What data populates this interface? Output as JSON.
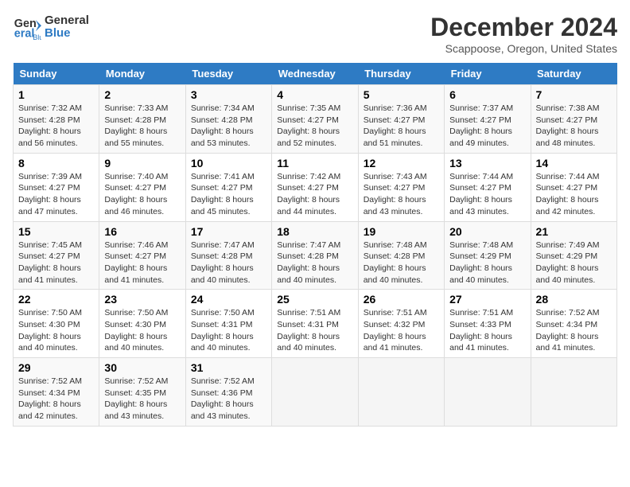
{
  "header": {
    "logo_line1": "General",
    "logo_line2": "Blue",
    "title": "December 2024",
    "subtitle": "Scappoose, Oregon, United States"
  },
  "weekdays": [
    "Sunday",
    "Monday",
    "Tuesday",
    "Wednesday",
    "Thursday",
    "Friday",
    "Saturday"
  ],
  "weeks": [
    [
      {
        "day": "1",
        "rise": "Sunrise: 7:32 AM",
        "set": "Sunset: 4:28 PM",
        "daylight": "Daylight: 8 hours and 56 minutes."
      },
      {
        "day": "2",
        "rise": "Sunrise: 7:33 AM",
        "set": "Sunset: 4:28 PM",
        "daylight": "Daylight: 8 hours and 55 minutes."
      },
      {
        "day": "3",
        "rise": "Sunrise: 7:34 AM",
        "set": "Sunset: 4:28 PM",
        "daylight": "Daylight: 8 hours and 53 minutes."
      },
      {
        "day": "4",
        "rise": "Sunrise: 7:35 AM",
        "set": "Sunset: 4:27 PM",
        "daylight": "Daylight: 8 hours and 52 minutes."
      },
      {
        "day": "5",
        "rise": "Sunrise: 7:36 AM",
        "set": "Sunset: 4:27 PM",
        "daylight": "Daylight: 8 hours and 51 minutes."
      },
      {
        "day": "6",
        "rise": "Sunrise: 7:37 AM",
        "set": "Sunset: 4:27 PM",
        "daylight": "Daylight: 8 hours and 49 minutes."
      },
      {
        "day": "7",
        "rise": "Sunrise: 7:38 AM",
        "set": "Sunset: 4:27 PM",
        "daylight": "Daylight: 8 hours and 48 minutes."
      }
    ],
    [
      {
        "day": "8",
        "rise": "Sunrise: 7:39 AM",
        "set": "Sunset: 4:27 PM",
        "daylight": "Daylight: 8 hours and 47 minutes."
      },
      {
        "day": "9",
        "rise": "Sunrise: 7:40 AM",
        "set": "Sunset: 4:27 PM",
        "daylight": "Daylight: 8 hours and 46 minutes."
      },
      {
        "day": "10",
        "rise": "Sunrise: 7:41 AM",
        "set": "Sunset: 4:27 PM",
        "daylight": "Daylight: 8 hours and 45 minutes."
      },
      {
        "day": "11",
        "rise": "Sunrise: 7:42 AM",
        "set": "Sunset: 4:27 PM",
        "daylight": "Daylight: 8 hours and 44 minutes."
      },
      {
        "day": "12",
        "rise": "Sunrise: 7:43 AM",
        "set": "Sunset: 4:27 PM",
        "daylight": "Daylight: 8 hours and 43 minutes."
      },
      {
        "day": "13",
        "rise": "Sunrise: 7:44 AM",
        "set": "Sunset: 4:27 PM",
        "daylight": "Daylight: 8 hours and 43 minutes."
      },
      {
        "day": "14",
        "rise": "Sunrise: 7:44 AM",
        "set": "Sunset: 4:27 PM",
        "daylight": "Daylight: 8 hours and 42 minutes."
      }
    ],
    [
      {
        "day": "15",
        "rise": "Sunrise: 7:45 AM",
        "set": "Sunset: 4:27 PM",
        "daylight": "Daylight: 8 hours and 41 minutes."
      },
      {
        "day": "16",
        "rise": "Sunrise: 7:46 AM",
        "set": "Sunset: 4:27 PM",
        "daylight": "Daylight: 8 hours and 41 minutes."
      },
      {
        "day": "17",
        "rise": "Sunrise: 7:47 AM",
        "set": "Sunset: 4:28 PM",
        "daylight": "Daylight: 8 hours and 40 minutes."
      },
      {
        "day": "18",
        "rise": "Sunrise: 7:47 AM",
        "set": "Sunset: 4:28 PM",
        "daylight": "Daylight: 8 hours and 40 minutes."
      },
      {
        "day": "19",
        "rise": "Sunrise: 7:48 AM",
        "set": "Sunset: 4:28 PM",
        "daylight": "Daylight: 8 hours and 40 minutes."
      },
      {
        "day": "20",
        "rise": "Sunrise: 7:48 AM",
        "set": "Sunset: 4:29 PM",
        "daylight": "Daylight: 8 hours and 40 minutes."
      },
      {
        "day": "21",
        "rise": "Sunrise: 7:49 AM",
        "set": "Sunset: 4:29 PM",
        "daylight": "Daylight: 8 hours and 40 minutes."
      }
    ],
    [
      {
        "day": "22",
        "rise": "Sunrise: 7:50 AM",
        "set": "Sunset: 4:30 PM",
        "daylight": "Daylight: 8 hours and 40 minutes."
      },
      {
        "day": "23",
        "rise": "Sunrise: 7:50 AM",
        "set": "Sunset: 4:30 PM",
        "daylight": "Daylight: 8 hours and 40 minutes."
      },
      {
        "day": "24",
        "rise": "Sunrise: 7:50 AM",
        "set": "Sunset: 4:31 PM",
        "daylight": "Daylight: 8 hours and 40 minutes."
      },
      {
        "day": "25",
        "rise": "Sunrise: 7:51 AM",
        "set": "Sunset: 4:31 PM",
        "daylight": "Daylight: 8 hours and 40 minutes."
      },
      {
        "day": "26",
        "rise": "Sunrise: 7:51 AM",
        "set": "Sunset: 4:32 PM",
        "daylight": "Daylight: 8 hours and 41 minutes."
      },
      {
        "day": "27",
        "rise": "Sunrise: 7:51 AM",
        "set": "Sunset: 4:33 PM",
        "daylight": "Daylight: 8 hours and 41 minutes."
      },
      {
        "day": "28",
        "rise": "Sunrise: 7:52 AM",
        "set": "Sunset: 4:34 PM",
        "daylight": "Daylight: 8 hours and 41 minutes."
      }
    ],
    [
      {
        "day": "29",
        "rise": "Sunrise: 7:52 AM",
        "set": "Sunset: 4:34 PM",
        "daylight": "Daylight: 8 hours and 42 minutes."
      },
      {
        "day": "30",
        "rise": "Sunrise: 7:52 AM",
        "set": "Sunset: 4:35 PM",
        "daylight": "Daylight: 8 hours and 43 minutes."
      },
      {
        "day": "31",
        "rise": "Sunrise: 7:52 AM",
        "set": "Sunset: 4:36 PM",
        "daylight": "Daylight: 8 hours and 43 minutes."
      },
      null,
      null,
      null,
      null
    ]
  ]
}
